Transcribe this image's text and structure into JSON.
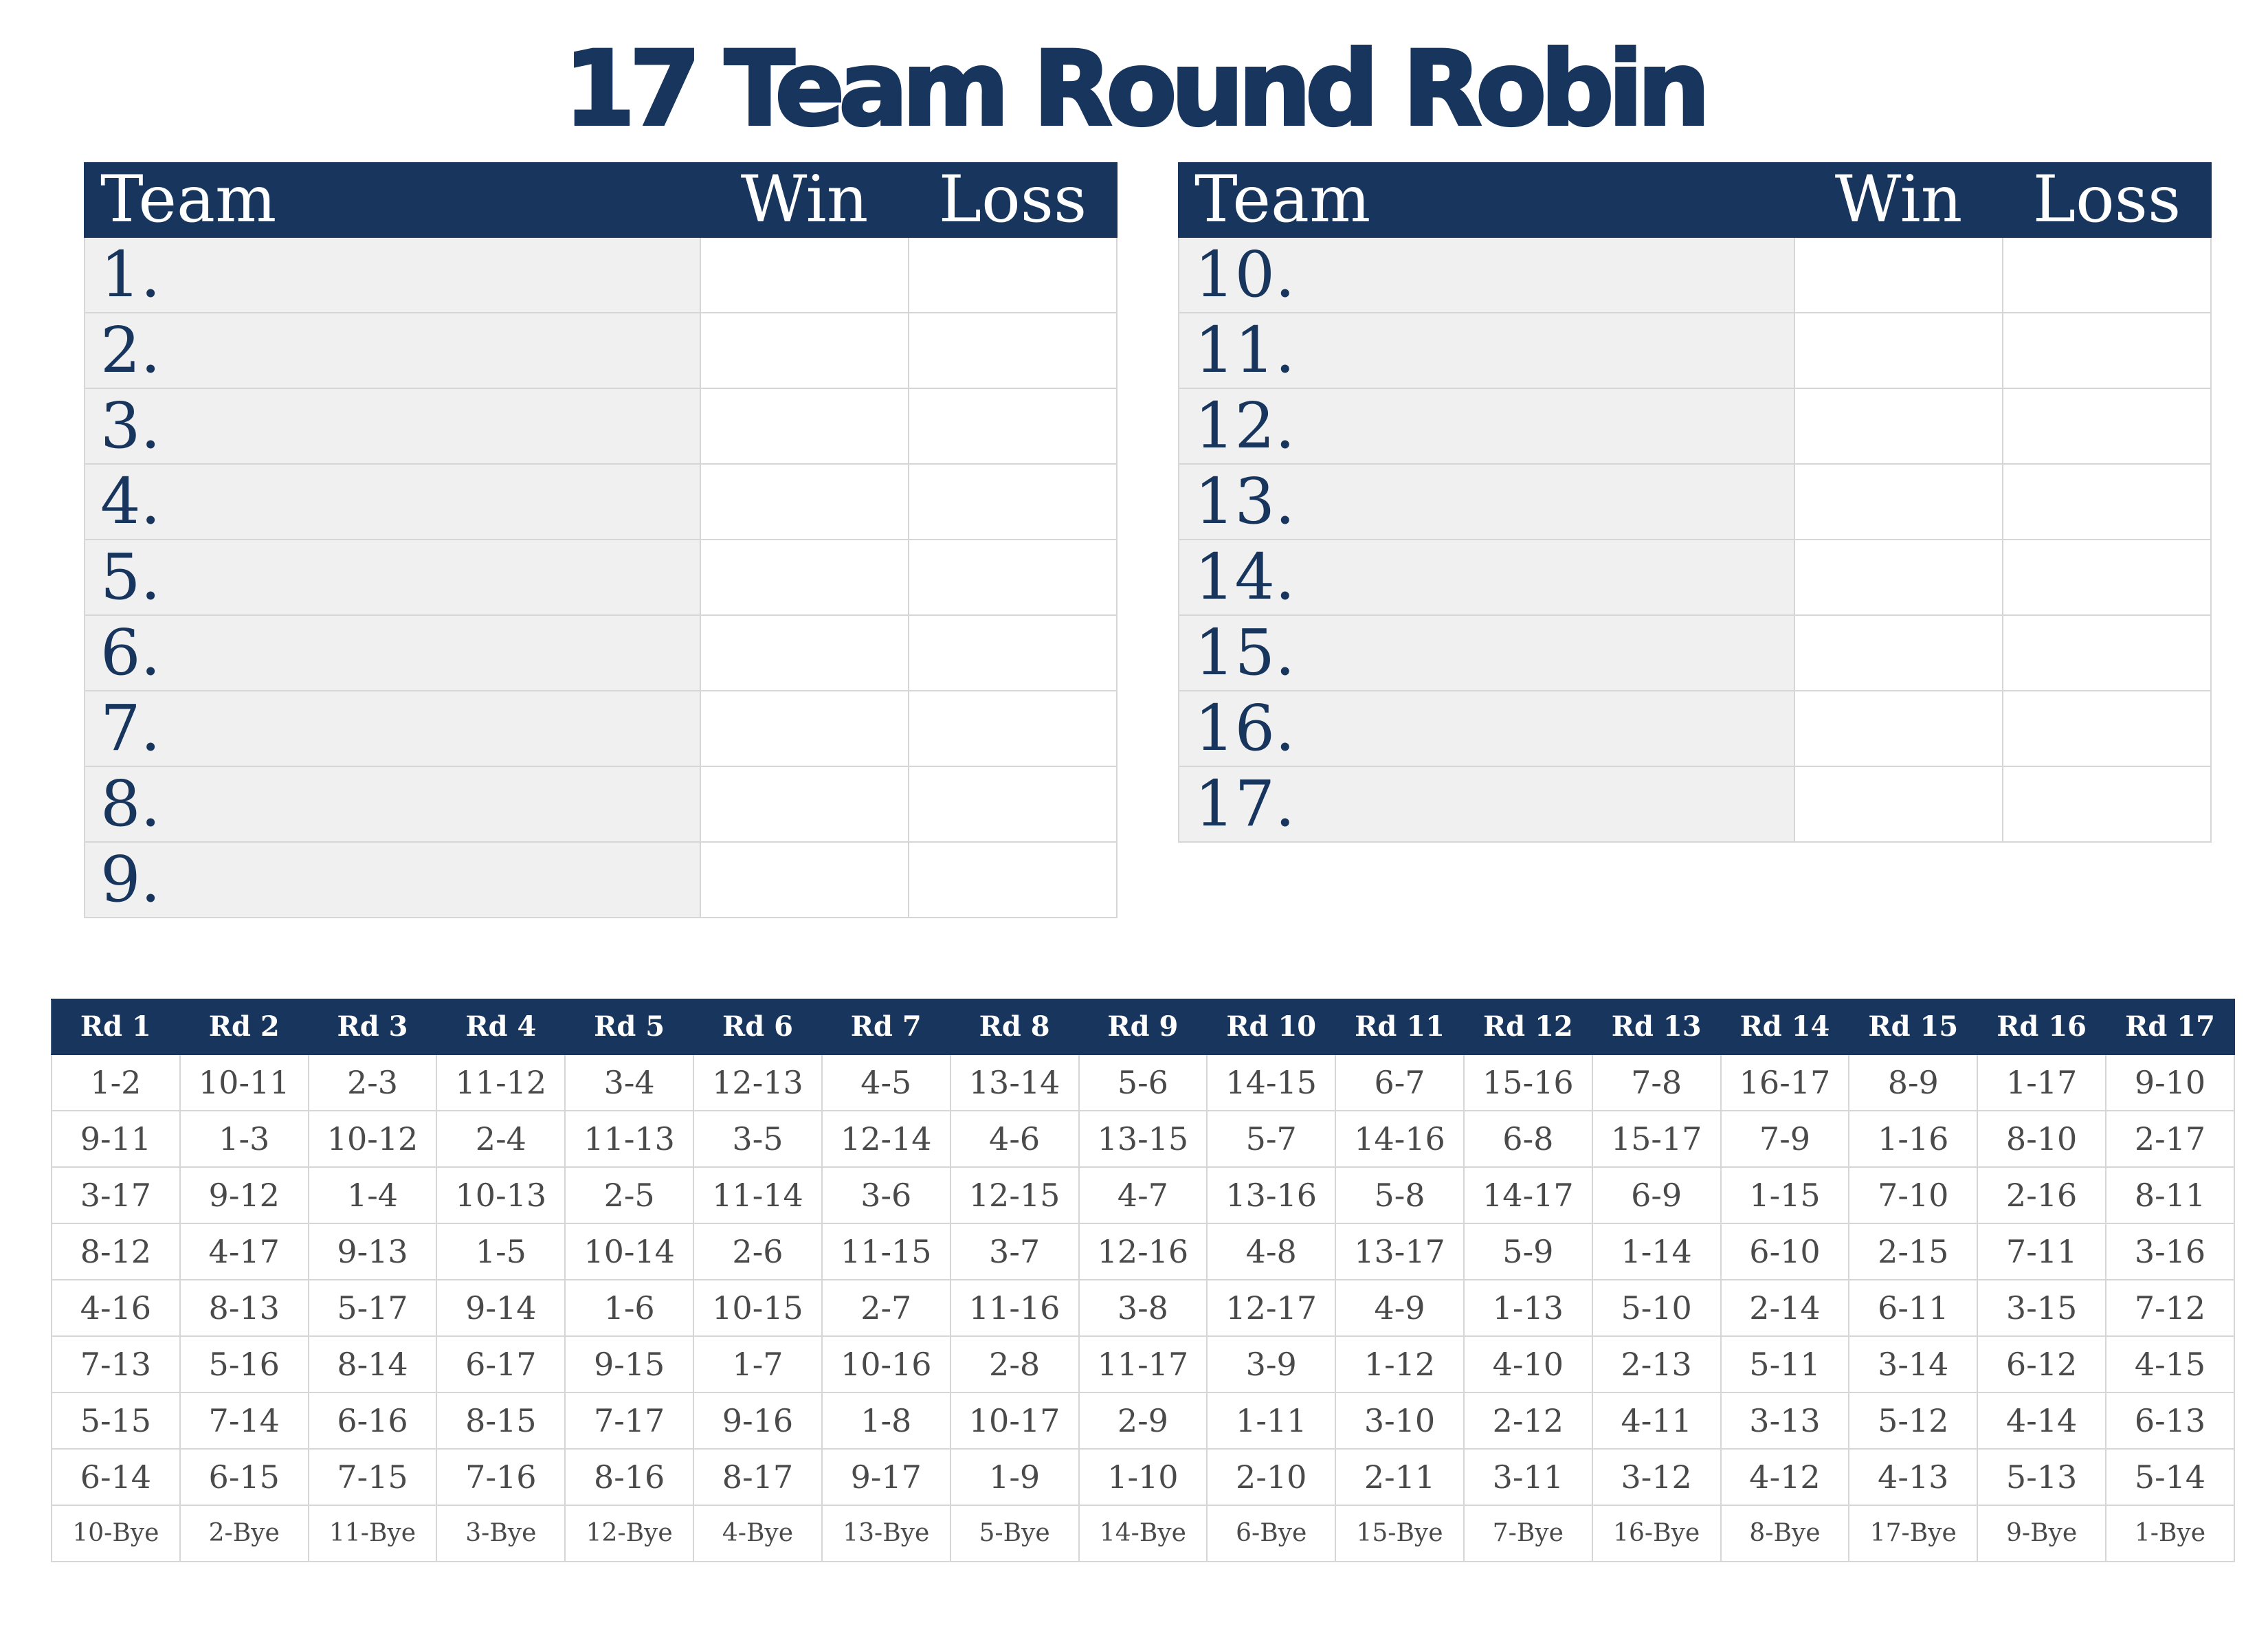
{
  "title": "17 Team Round Robin",
  "standings": {
    "headers": {
      "team": "Team",
      "win": "Win",
      "loss": "Loss"
    },
    "left_teams": [
      "1.",
      "2.",
      "3.",
      "4.",
      "5.",
      "6.",
      "7.",
      "8.",
      "9."
    ],
    "right_teams": [
      "10.",
      "11.",
      "12.",
      "13.",
      "14.",
      "15.",
      "16.",
      "17."
    ]
  },
  "schedule": {
    "rounds": [
      "Rd 1",
      "Rd 2",
      "Rd 3",
      "Rd 4",
      "Rd 5",
      "Rd 6",
      "Rd 7",
      "Rd 8",
      "Rd 9",
      "Rd 10",
      "Rd 11",
      "Rd 12",
      "Rd 13",
      "Rd 14",
      "Rd 15",
      "Rd 16",
      "Rd 17"
    ],
    "rows": [
      [
        "1-2",
        "10-11",
        "2-3",
        "11-12",
        "3-4",
        "12-13",
        "4-5",
        "13-14",
        "5-6",
        "14-15",
        "6-7",
        "15-16",
        "7-8",
        "16-17",
        "8-9",
        "1-17",
        "9-10"
      ],
      [
        "9-11",
        "1-3",
        "10-12",
        "2-4",
        "11-13",
        "3-5",
        "12-14",
        "4-6",
        "13-15",
        "5-7",
        "14-16",
        "6-8",
        "15-17",
        "7-9",
        "1-16",
        "8-10",
        "2-17"
      ],
      [
        "3-17",
        "9-12",
        "1-4",
        "10-13",
        "2-5",
        "11-14",
        "3-6",
        "12-15",
        "4-7",
        "13-16",
        "5-8",
        "14-17",
        "6-9",
        "1-15",
        "7-10",
        "2-16",
        "8-11"
      ],
      [
        "8-12",
        "4-17",
        "9-13",
        "1-5",
        "10-14",
        "2-6",
        "11-15",
        "3-7",
        "12-16",
        "4-8",
        "13-17",
        "5-9",
        "1-14",
        "6-10",
        "2-15",
        "7-11",
        "3-16"
      ],
      [
        "4-16",
        "8-13",
        "5-17",
        "9-14",
        "1-6",
        "10-15",
        "2-7",
        "11-16",
        "3-8",
        "12-17",
        "4-9",
        "1-13",
        "5-10",
        "2-14",
        "6-11",
        "3-15",
        "7-12"
      ],
      [
        "7-13",
        "5-16",
        "8-14",
        "6-17",
        "9-15",
        "1-7",
        "10-16",
        "2-8",
        "11-17",
        "3-9",
        "1-12",
        "4-10",
        "2-13",
        "5-11",
        "3-14",
        "6-12",
        "4-15"
      ],
      [
        "5-15",
        "7-14",
        "6-16",
        "8-15",
        "7-17",
        "9-16",
        "1-8",
        "10-17",
        "2-9",
        "1-11",
        "3-10",
        "2-12",
        "4-11",
        "3-13",
        "5-12",
        "4-14",
        "6-13"
      ],
      [
        "6-14",
        "6-15",
        "7-15",
        "7-16",
        "8-16",
        "8-17",
        "9-17",
        "1-9",
        "1-10",
        "2-10",
        "2-11",
        "3-11",
        "3-12",
        "4-12",
        "4-13",
        "5-13",
        "5-14"
      ]
    ],
    "byes": [
      "10-Bye",
      "2-Bye",
      "11-Bye",
      "3-Bye",
      "12-Bye",
      "4-Bye",
      "13-Bye",
      "5-Bye",
      "14-Bye",
      "6-Bye",
      "15-Bye",
      "7-Bye",
      "16-Bye",
      "8-Bye",
      "17-Bye",
      "9-Bye",
      "1-Bye"
    ]
  }
}
